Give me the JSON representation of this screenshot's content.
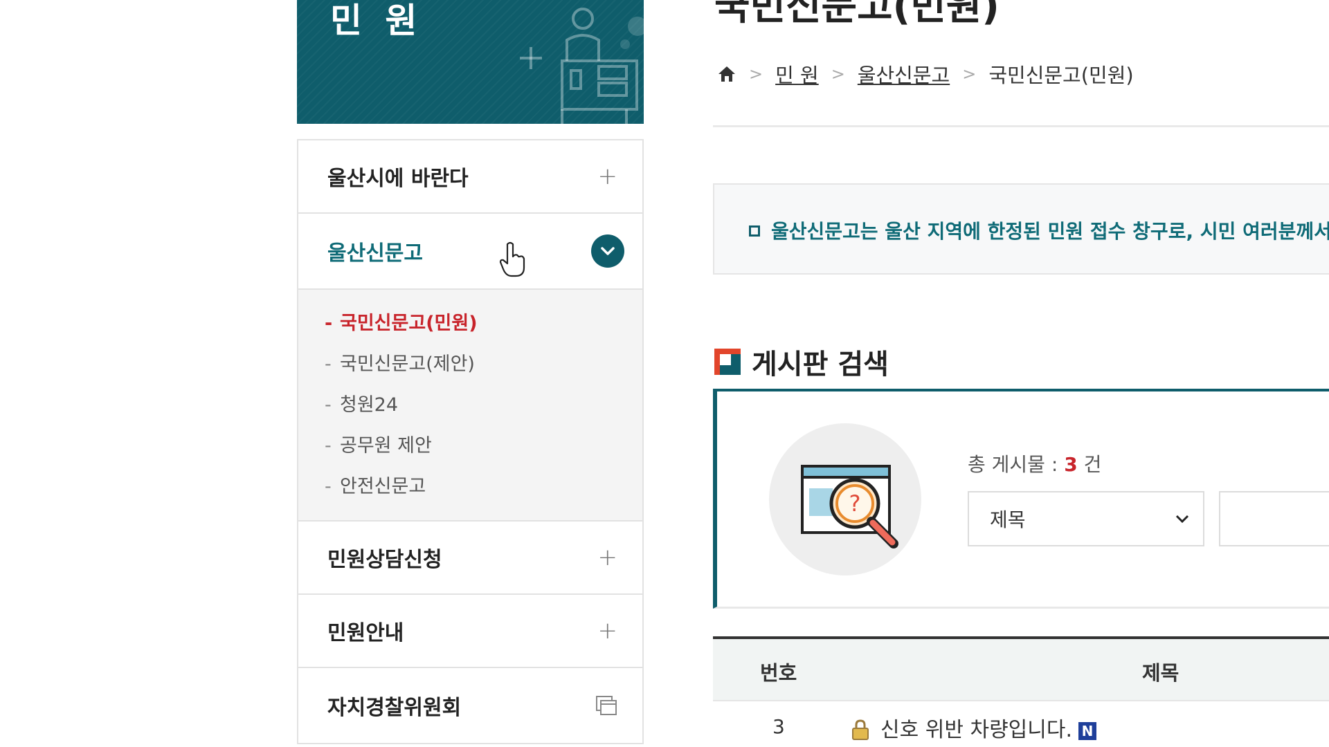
{
  "sidebar": {
    "banner_title": "민 원",
    "menu": [
      {
        "label": "울산시에 바란다",
        "state": "collapsed"
      },
      {
        "label": "울산신문고",
        "state": "expanded"
      },
      {
        "label": "민원상담신청",
        "state": "collapsed"
      },
      {
        "label": "민원안내",
        "state": "collapsed"
      },
      {
        "label": "자치경찰위원회",
        "state": "external"
      }
    ],
    "submenu": [
      {
        "label": "국민신문고(민원)"
      },
      {
        "label": "국민신문고(제안)"
      },
      {
        "label": "청원24"
      },
      {
        "label": "공무원 제안"
      },
      {
        "label": "안전신문고"
      }
    ],
    "dash": "-",
    "plus": "+"
  },
  "main": {
    "page_title": "국민신문고(민원)",
    "breadcrumb": {
      "items": [
        "민 원",
        "울산신문고",
        "국민신문고(민원)"
      ],
      "separator": ">"
    },
    "notice_text": "울산신문고는 울산 지역에 한정된 민원 접수 창구로, 시민 여러분께서",
    "section_title": "게시판 검색",
    "search": {
      "total_label": "총 게시물 : ",
      "total_count": "3",
      "total_unit": " 건",
      "select_value": "제목"
    },
    "table": {
      "headers": [
        "번호",
        "제목"
      ],
      "rows": [
        {
          "num": "3",
          "title": "신호 위반 차량입니다.",
          "badge": "N"
        }
      ]
    }
  },
  "colors": {
    "brand_teal": "#0f5d6b",
    "accent_red": "#c8242b",
    "badge_blue": "#1f3f9a"
  },
  "icons": [
    "home-icon",
    "plus-icon",
    "chevron-down-icon",
    "new-window-icon",
    "lock-icon",
    "search-illustration",
    "hand-cursor"
  ]
}
